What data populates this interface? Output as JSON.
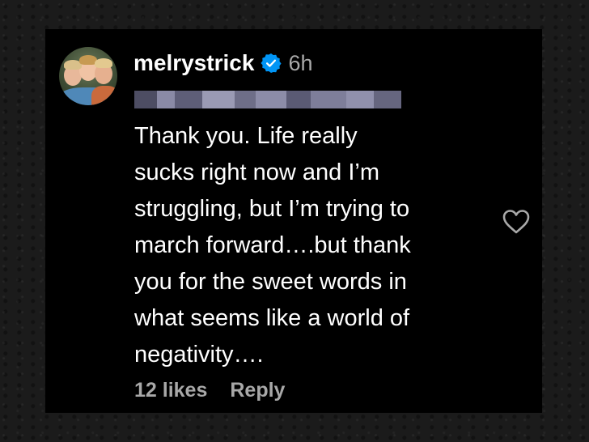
{
  "comment": {
    "username": "melrystrick",
    "time": "6h",
    "lines": [
      "Thank you. Life really",
      "sucks right now and I’m",
      "struggling, but I’m trying to",
      "march forward….but thank",
      "you for the sweet words in",
      "what seems like a world of",
      "negativity…."
    ],
    "likes_label": "12 likes",
    "reply_label": "Reply"
  },
  "icons": {
    "verified": "verified-badge-icon",
    "like": "heart-icon",
    "avatar": "profile-avatar"
  },
  "colors": {
    "background": "#000000",
    "text": "#ffffff",
    "muted": "#a8a8a8",
    "verified": "#0095f6"
  }
}
